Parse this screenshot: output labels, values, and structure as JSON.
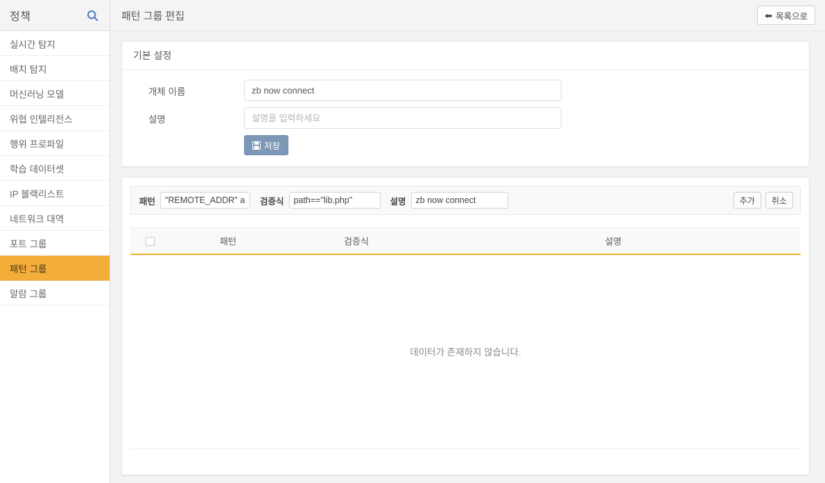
{
  "sidebar": {
    "title": "정책",
    "search_icon": "search-icon",
    "items": [
      {
        "label": "실시간 탐지",
        "active": false
      },
      {
        "label": "배치 탐지",
        "active": false
      },
      {
        "label": "머신러닝 모델",
        "active": false
      },
      {
        "label": "위협 인텔리전스",
        "active": false
      },
      {
        "label": "행위 프로파일",
        "active": false
      },
      {
        "label": "학습 데이터셋",
        "active": false
      },
      {
        "label": "IP 블랙리스트",
        "active": false
      },
      {
        "label": "네트워크 대역",
        "active": false
      },
      {
        "label": "포트 그룹",
        "active": false
      },
      {
        "label": "패턴 그룹",
        "active": true
      },
      {
        "label": "알람 그룹",
        "active": false
      }
    ]
  },
  "topbar": {
    "page_title": "패턴 그룹 편집",
    "back_button": "목록으로",
    "back_icon": "arrow-left-icon"
  },
  "basic_panel": {
    "heading": "기본 설정",
    "name_label": "개체 이름",
    "name_value": "zb now connect",
    "desc_label": "설명",
    "desc_value": "",
    "desc_placeholder": "설명을 입력하세요",
    "save_label": "저장",
    "save_icon": "floppy-disk-icon"
  },
  "pattern_panel": {
    "toolbar": {
      "pattern_label": "패턴",
      "pattern_value": "\"REMOTE_ADDR\" and",
      "expr_label": "검증식",
      "expr_value": "path==\"lib.php\"",
      "desc_label": "설명",
      "desc_value": "zb now connect",
      "add_label": "추가",
      "cancel_label": "취소"
    },
    "table": {
      "columns": [
        "",
        "패턴",
        "검증식",
        "설명"
      ],
      "rows": [],
      "empty_message": "데이터가 존재하지 않습니다."
    }
  },
  "colors": {
    "accent_orange": "#f5ad3a",
    "table_underline": "#f0ad33",
    "save_button": "#7d98b7",
    "search_icon": "#4a7bbf",
    "page_background": "#f2f3f3"
  }
}
